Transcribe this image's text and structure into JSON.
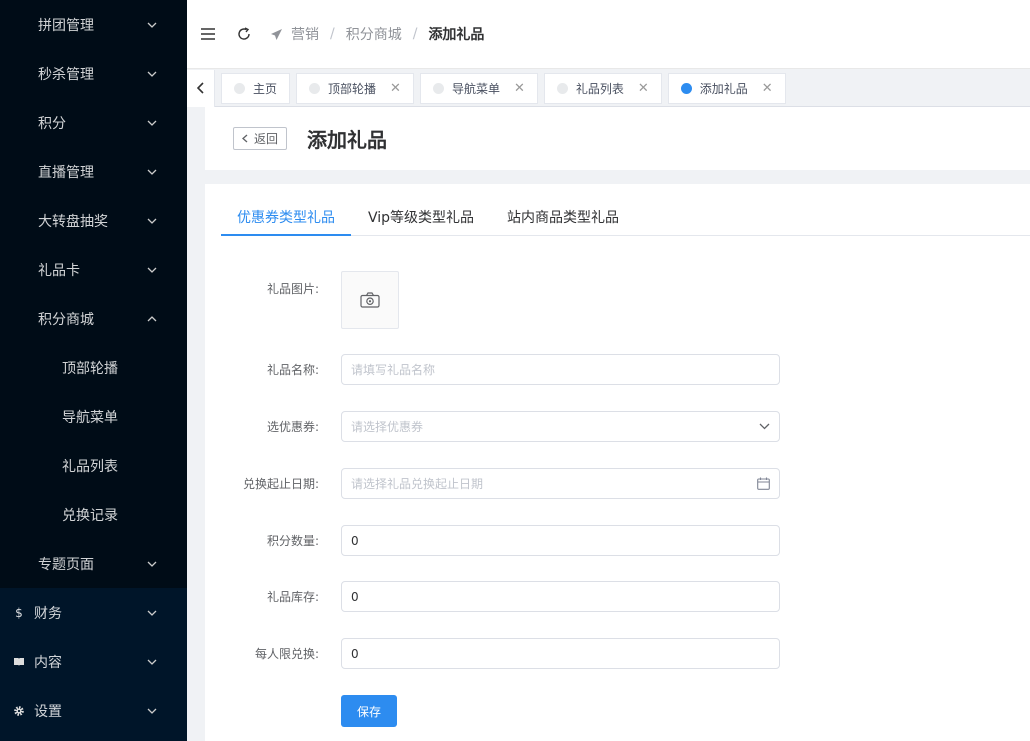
{
  "sidebar": {
    "items": [
      {
        "label": "拼团管理"
      },
      {
        "label": "秒杀管理"
      },
      {
        "label": "积分"
      },
      {
        "label": "直播管理"
      },
      {
        "label": "大转盘抽奖"
      },
      {
        "label": "礼品卡"
      },
      {
        "label": "积分商城"
      },
      {
        "label": "顶部轮播"
      },
      {
        "label": "导航菜单"
      },
      {
        "label": "礼品列表"
      },
      {
        "label": "兑换记录"
      },
      {
        "label": "专题页面"
      },
      {
        "label": "财务",
        "icon": "dollar-icon",
        "glyph": "$"
      },
      {
        "label": "内容",
        "icon": "book-icon"
      },
      {
        "label": "设置",
        "icon": "gear-icon"
      }
    ]
  },
  "header": {
    "breadcrumb": [
      "营销",
      "积分商城",
      "添加礼品"
    ],
    "sep": "/"
  },
  "tabs": [
    {
      "label": "主页"
    },
    {
      "label": "顶部轮播"
    },
    {
      "label": "导航菜单"
    },
    {
      "label": "礼品列表"
    },
    {
      "label": "添加礼品"
    }
  ],
  "page": {
    "back_label": "返回",
    "title": "添加礼品"
  },
  "content_tabs": [
    {
      "label": "优惠券类型礼品"
    },
    {
      "label": "Vip等级类型礼品"
    },
    {
      "label": "站内商品类型礼品"
    }
  ],
  "form": {
    "image_label": "礼品图片:",
    "name_label": "礼品名称:",
    "name_placeholder": "请填写礼品名称",
    "coupon_label": "选优惠券:",
    "coupon_placeholder": "请选择优惠券",
    "date_label": "兑换起止日期:",
    "date_placeholder": "请选择礼品兑换起止日期",
    "points_label": "积分数量:",
    "points_value": "0",
    "stock_label": "礼品库存:",
    "stock_value": "0",
    "limit_label": "每人限兑换:",
    "limit_value": "0",
    "save_label": "保存"
  },
  "colors": {
    "accent": "#2d8cf0",
    "sidebar_bg": "#001529"
  }
}
